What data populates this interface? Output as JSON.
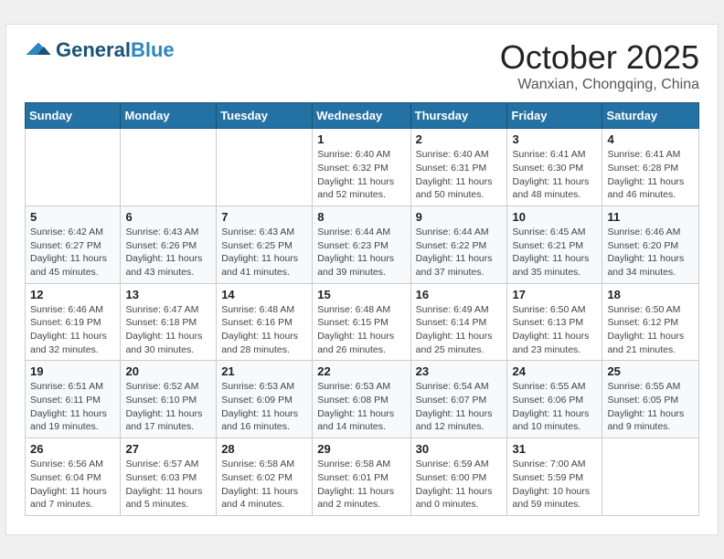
{
  "header": {
    "logo_line1": "General",
    "logo_line2": "Blue",
    "month_title": "October 2025",
    "location": "Wanxian, Chongqing, China"
  },
  "weekdays": [
    "Sunday",
    "Monday",
    "Tuesday",
    "Wednesday",
    "Thursday",
    "Friday",
    "Saturday"
  ],
  "weeks": [
    [
      {
        "day": "",
        "info": ""
      },
      {
        "day": "",
        "info": ""
      },
      {
        "day": "",
        "info": ""
      },
      {
        "day": "1",
        "info": "Sunrise: 6:40 AM\nSunset: 6:32 PM\nDaylight: 11 hours\nand 52 minutes."
      },
      {
        "day": "2",
        "info": "Sunrise: 6:40 AM\nSunset: 6:31 PM\nDaylight: 11 hours\nand 50 minutes."
      },
      {
        "day": "3",
        "info": "Sunrise: 6:41 AM\nSunset: 6:30 PM\nDaylight: 11 hours\nand 48 minutes."
      },
      {
        "day": "4",
        "info": "Sunrise: 6:41 AM\nSunset: 6:28 PM\nDaylight: 11 hours\nand 46 minutes."
      }
    ],
    [
      {
        "day": "5",
        "info": "Sunrise: 6:42 AM\nSunset: 6:27 PM\nDaylight: 11 hours\nand 45 minutes."
      },
      {
        "day": "6",
        "info": "Sunrise: 6:43 AM\nSunset: 6:26 PM\nDaylight: 11 hours\nand 43 minutes."
      },
      {
        "day": "7",
        "info": "Sunrise: 6:43 AM\nSunset: 6:25 PM\nDaylight: 11 hours\nand 41 minutes."
      },
      {
        "day": "8",
        "info": "Sunrise: 6:44 AM\nSunset: 6:23 PM\nDaylight: 11 hours\nand 39 minutes."
      },
      {
        "day": "9",
        "info": "Sunrise: 6:44 AM\nSunset: 6:22 PM\nDaylight: 11 hours\nand 37 minutes."
      },
      {
        "day": "10",
        "info": "Sunrise: 6:45 AM\nSunset: 6:21 PM\nDaylight: 11 hours\nand 35 minutes."
      },
      {
        "day": "11",
        "info": "Sunrise: 6:46 AM\nSunset: 6:20 PM\nDaylight: 11 hours\nand 34 minutes."
      }
    ],
    [
      {
        "day": "12",
        "info": "Sunrise: 6:46 AM\nSunset: 6:19 PM\nDaylight: 11 hours\nand 32 minutes."
      },
      {
        "day": "13",
        "info": "Sunrise: 6:47 AM\nSunset: 6:18 PM\nDaylight: 11 hours\nand 30 minutes."
      },
      {
        "day": "14",
        "info": "Sunrise: 6:48 AM\nSunset: 6:16 PM\nDaylight: 11 hours\nand 28 minutes."
      },
      {
        "day": "15",
        "info": "Sunrise: 6:48 AM\nSunset: 6:15 PM\nDaylight: 11 hours\nand 26 minutes."
      },
      {
        "day": "16",
        "info": "Sunrise: 6:49 AM\nSunset: 6:14 PM\nDaylight: 11 hours\nand 25 minutes."
      },
      {
        "day": "17",
        "info": "Sunrise: 6:50 AM\nSunset: 6:13 PM\nDaylight: 11 hours\nand 23 minutes."
      },
      {
        "day": "18",
        "info": "Sunrise: 6:50 AM\nSunset: 6:12 PM\nDaylight: 11 hours\nand 21 minutes."
      }
    ],
    [
      {
        "day": "19",
        "info": "Sunrise: 6:51 AM\nSunset: 6:11 PM\nDaylight: 11 hours\nand 19 minutes."
      },
      {
        "day": "20",
        "info": "Sunrise: 6:52 AM\nSunset: 6:10 PM\nDaylight: 11 hours\nand 17 minutes."
      },
      {
        "day": "21",
        "info": "Sunrise: 6:53 AM\nSunset: 6:09 PM\nDaylight: 11 hours\nand 16 minutes."
      },
      {
        "day": "22",
        "info": "Sunrise: 6:53 AM\nSunset: 6:08 PM\nDaylight: 11 hours\nand 14 minutes."
      },
      {
        "day": "23",
        "info": "Sunrise: 6:54 AM\nSunset: 6:07 PM\nDaylight: 11 hours\nand 12 minutes."
      },
      {
        "day": "24",
        "info": "Sunrise: 6:55 AM\nSunset: 6:06 PM\nDaylight: 11 hours\nand 10 minutes."
      },
      {
        "day": "25",
        "info": "Sunrise: 6:55 AM\nSunset: 6:05 PM\nDaylight: 11 hours\nand 9 minutes."
      }
    ],
    [
      {
        "day": "26",
        "info": "Sunrise: 6:56 AM\nSunset: 6:04 PM\nDaylight: 11 hours\nand 7 minutes."
      },
      {
        "day": "27",
        "info": "Sunrise: 6:57 AM\nSunset: 6:03 PM\nDaylight: 11 hours\nand 5 minutes."
      },
      {
        "day": "28",
        "info": "Sunrise: 6:58 AM\nSunset: 6:02 PM\nDaylight: 11 hours\nand 4 minutes."
      },
      {
        "day": "29",
        "info": "Sunrise: 6:58 AM\nSunset: 6:01 PM\nDaylight: 11 hours\nand 2 minutes."
      },
      {
        "day": "30",
        "info": "Sunrise: 6:59 AM\nSunset: 6:00 PM\nDaylight: 11 hours\nand 0 minutes."
      },
      {
        "day": "31",
        "info": "Sunrise: 7:00 AM\nSunset: 5:59 PM\nDaylight: 10 hours\nand 59 minutes."
      },
      {
        "day": "",
        "info": ""
      }
    ]
  ]
}
